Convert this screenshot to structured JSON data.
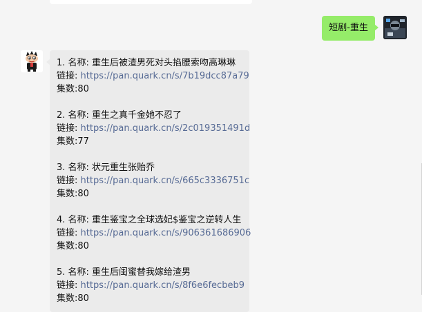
{
  "sent_message": {
    "text": "短剧-重生"
  },
  "reply": {
    "link_label": "链接: ",
    "items": [
      {
        "title": "1. 名称: 重生后被渣男死对头掐腰索吻高琳琳",
        "url": "https://pan.quark.cn/s/7b19dcc87a79",
        "episodes": "集数:80"
      },
      {
        "title": "2. 名称: 重生之真千金她不忍了",
        "url": "https://pan.quark.cn/s/2c019351491d",
        "episodes": "集数:77"
      },
      {
        "title": "3. 名称: 状元重生张贻乔",
        "url": "https://pan.quark.cn/s/665c3336751c",
        "episodes": "集数:80"
      },
      {
        "title": "4. 名称: 重生鉴宝之全球选妃$鉴宝之逆转人生",
        "url": "https://pan.quark.cn/s/906361686906",
        "episodes": "集数:80"
      },
      {
        "title": "5. 名称: 重生后闺蜜替我嫁给渣男",
        "url": "https://pan.quark.cn/s/8f6e6fecbeb9",
        "episodes": "集数:80"
      }
    ]
  }
}
